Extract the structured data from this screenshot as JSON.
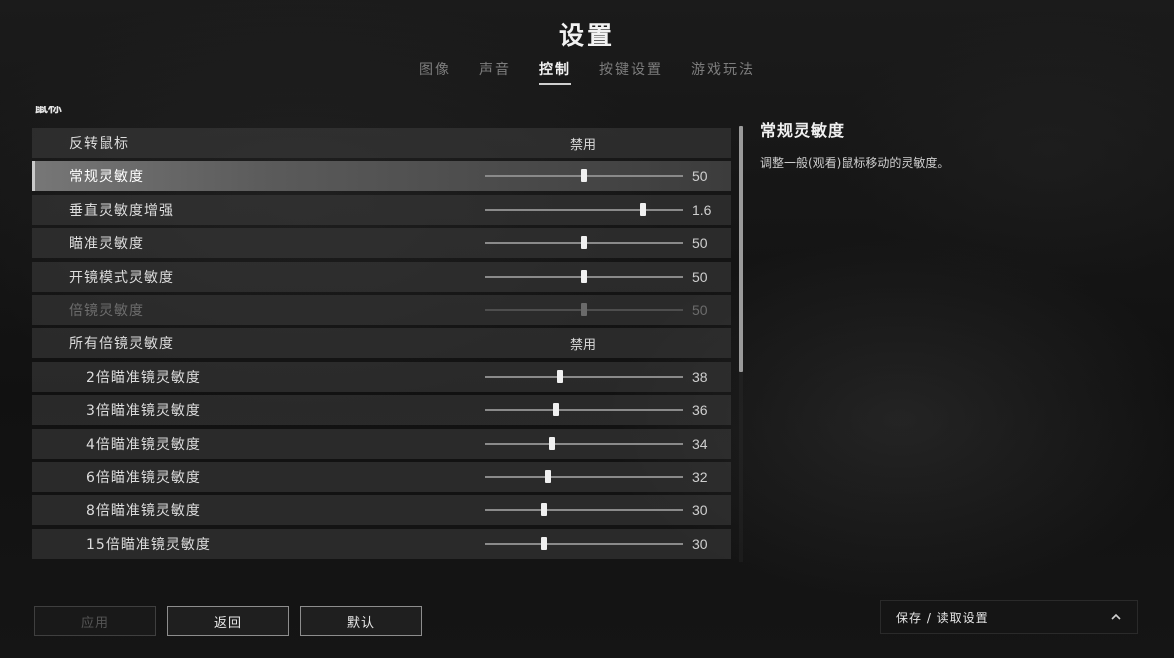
{
  "header": {
    "title": "设置",
    "tabs": [
      {
        "label": "图像"
      },
      {
        "label": "声音"
      },
      {
        "label": "控制"
      },
      {
        "label": "按键设置"
      },
      {
        "label": "游戏玩法"
      }
    ],
    "active_tab": "控制"
  },
  "section_label": "鼠标",
  "settings": [
    {
      "label": "反转鼠标",
      "type": "toggle",
      "value": "禁用"
    },
    {
      "label": "常规灵敏度",
      "type": "slider",
      "value": "50",
      "fraction": 0.5,
      "selected": true
    },
    {
      "label": "垂直灵敏度增强",
      "type": "slider",
      "value": "1.6",
      "fraction": 0.8
    },
    {
      "label": "瞄准灵敏度",
      "type": "slider",
      "value": "50",
      "fraction": 0.5
    },
    {
      "label": "开镜模式灵敏度",
      "type": "slider",
      "value": "50",
      "fraction": 0.5
    },
    {
      "label": "倍镜灵敏度",
      "type": "slider",
      "value": "50",
      "fraction": 0.5,
      "disabled": true
    },
    {
      "label": "所有倍镜灵敏度",
      "type": "toggle",
      "value": "禁用"
    },
    {
      "label": "2倍瞄准镜灵敏度",
      "type": "slider",
      "value": "38",
      "fraction": 0.38,
      "sub": true
    },
    {
      "label": "3倍瞄准镜灵敏度",
      "type": "slider",
      "value": "36",
      "fraction": 0.36,
      "sub": true
    },
    {
      "label": "4倍瞄准镜灵敏度",
      "type": "slider",
      "value": "34",
      "fraction": 0.34,
      "sub": true
    },
    {
      "label": "6倍瞄准镜灵敏度",
      "type": "slider",
      "value": "32",
      "fraction": 0.32,
      "sub": true
    },
    {
      "label": "8倍瞄准镜灵敏度",
      "type": "slider",
      "value": "30",
      "fraction": 0.3,
      "sub": true
    },
    {
      "label": "15倍瞄准镜灵敏度",
      "type": "slider",
      "value": "30",
      "fraction": 0.3,
      "sub": true
    }
  ],
  "description": {
    "title": "常规灵敏度",
    "text": "调整一般(观看)鼠标移动的灵敏度。"
  },
  "buttons": {
    "apply": "应用",
    "back": "返回",
    "default": "默认"
  },
  "save_panel": {
    "label": "保存 / 读取设置",
    "icon": "chevron-up-icon"
  },
  "colors": {
    "background": "#141414",
    "row": "#3e3e3e",
    "selected_row": "#777777",
    "slider_thumb": "#f0f0f0",
    "text": "#dcdcdc",
    "disabled_text": "#6c6c6c"
  }
}
